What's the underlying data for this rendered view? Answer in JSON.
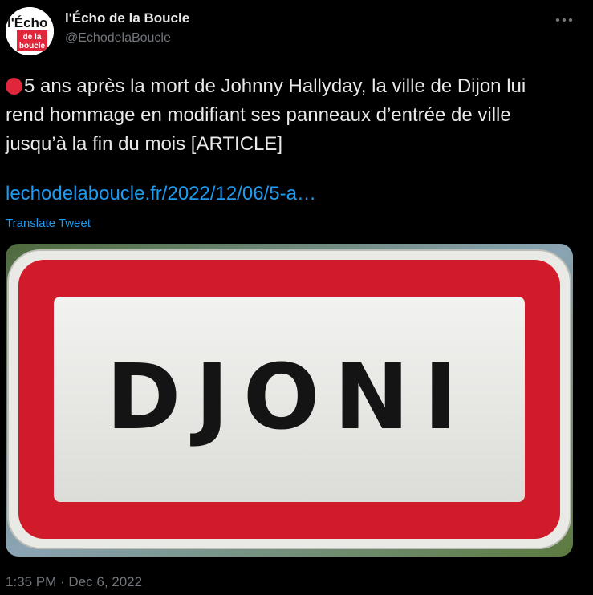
{
  "author": {
    "display_name": "l'Écho de la Boucle",
    "handle": "@EchodelaBoucle",
    "avatar_icon": "logo-icon",
    "avatar_text": {
      "top": "l'Écho",
      "middle": "de la",
      "bottom": "boucle"
    }
  },
  "tweet": {
    "status_icon": "red-circle-icon",
    "text": "5 ans après la mort de Johnny Hallyday, la ville de Dijon lui rend hommage en modifiant ses panneaux d’entrée de ville jusqu’à la fin du mois [ARTICLE]",
    "link": "lechodelaboucle.fr/2022/12/06/5-a…",
    "translate_label": "Translate Tweet",
    "timestamp": "1:35 PM · Dec 6, 2022"
  },
  "media": {
    "sign_text": "DJONI",
    "sign_border_color": "#d11a2a"
  },
  "actions": {
    "more_icon": "more-horizontal-icon"
  },
  "colors": {
    "background": "#000000",
    "text": "#e7e9ea",
    "secondary": "#71767b",
    "link": "#1d9bf0"
  }
}
